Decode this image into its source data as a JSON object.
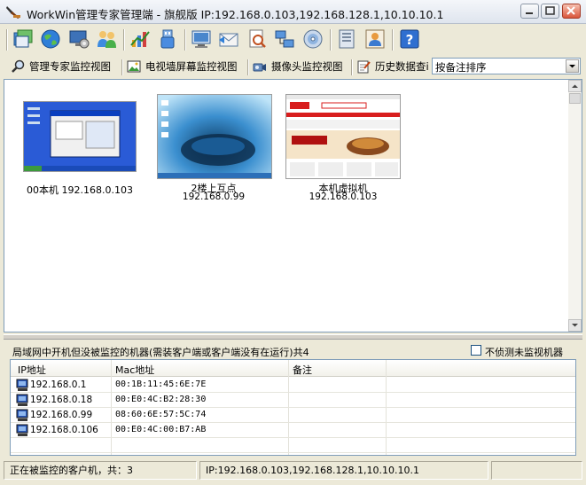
{
  "window": {
    "title": "WorkWin管理专家管理端 - 旗舰版 IP:192.168.0.103,192.168.128.1,10.10.10.1"
  },
  "toolbar": {
    "buttons": [
      "app-window-icon",
      "globe-icon",
      "settings-monitor-icon",
      "users-icon",
      "chart-icon",
      "usb-icon",
      "computer-icon",
      "mail-icon",
      "document-search-icon",
      "network-icon",
      "disc-icon",
      "print-icon",
      "user-card-icon",
      "help-icon"
    ]
  },
  "tabs": [
    {
      "label": "管理专家监控视图",
      "icon": "search-magnifier-icon"
    },
    {
      "label": "电视墙屏幕监控视图",
      "icon": "picture-icon"
    },
    {
      "label": "摄像头监控视图",
      "icon": "camera-icon"
    },
    {
      "label": "历史数据查i",
      "icon": "notepad-icon"
    }
  ],
  "sort_select": {
    "value": "按备注排序"
  },
  "monitors": [
    {
      "name": "00本机 192.168.0.103",
      "ip": ""
    },
    {
      "name": "2楼上互点",
      "ip": "192.168.0.99"
    },
    {
      "name": "本机虚拟机",
      "ip": "192.168.0.103"
    }
  ],
  "lan_panel": {
    "heading": "局域网中开机但没被监控的机器(需装客户端或客户端没有在运行)共4",
    "checkbox_label": "不侦测未监视机器",
    "columns": [
      "IP地址",
      "Mac地址",
      "备注"
    ],
    "rows": [
      {
        "ip": "192.168.0.1",
        "mac": "00:1B:11:45:6E:7E",
        "note": ""
      },
      {
        "ip": "192.168.0.18",
        "mac": "00:E0:4C:B2:28:30",
        "note": ""
      },
      {
        "ip": "192.168.0.99",
        "mac": "08:60:6E:57:5C:74",
        "note": ""
      },
      {
        "ip": "192.168.0.106",
        "mac": "00:E0:4C:00:B7:AB",
        "note": ""
      }
    ]
  },
  "status": {
    "left": "正在被监控的客户机，共：3",
    "right": "IP:192.168.0.103,192.168.128.1,10.10.10.1"
  }
}
